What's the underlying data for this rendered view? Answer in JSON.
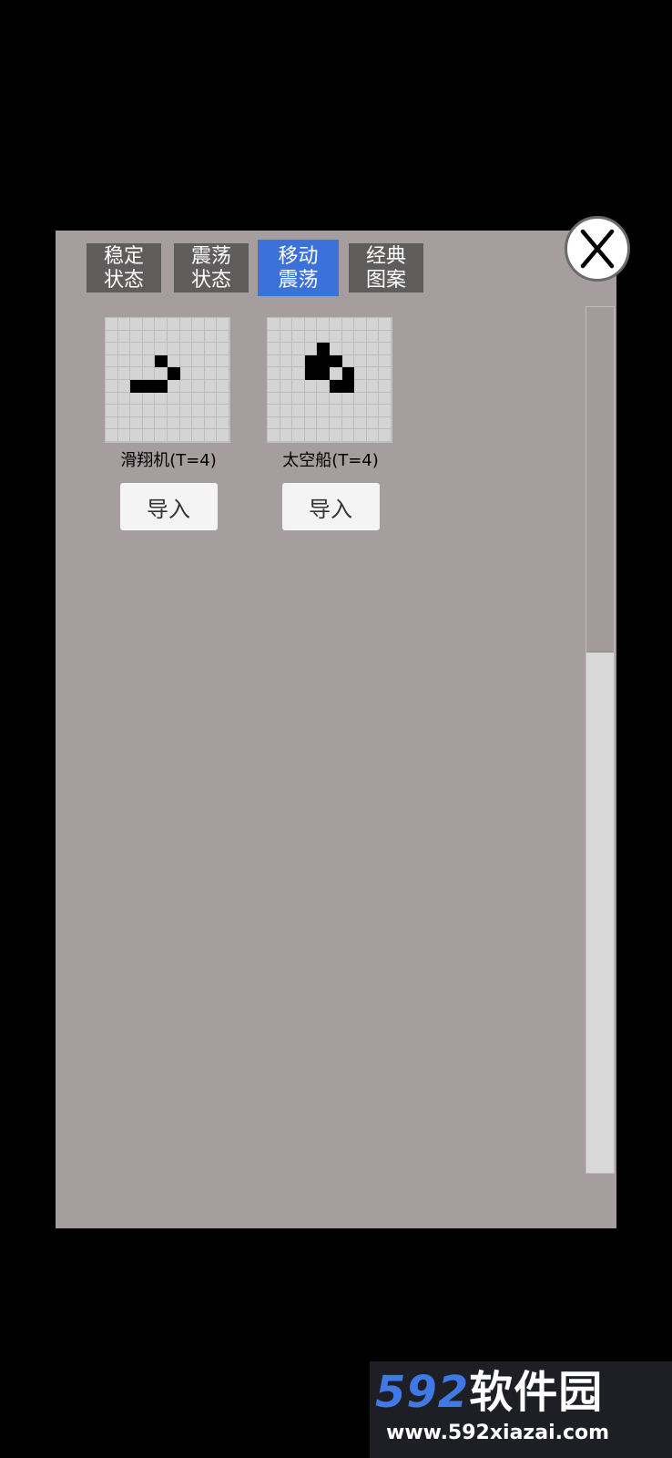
{
  "tabs": [
    {
      "label": "稳定\n状态",
      "active": false
    },
    {
      "label": "震荡\n状态",
      "active": false
    },
    {
      "label": "移动\n震荡",
      "active": true
    },
    {
      "label": "经典\n图案",
      "active": false
    }
  ],
  "close_label": "X",
  "patterns": [
    {
      "name": "滑翔机(T=4)",
      "import_label": "导入",
      "grid_size": 10,
      "alive_cells": [
        [
          3,
          4
        ],
        [
          4,
          5
        ],
        [
          5,
          2
        ],
        [
          5,
          3
        ],
        [
          5,
          4
        ]
      ]
    },
    {
      "name": "太空船(T=4)",
      "import_label": "导入",
      "grid_size": 10,
      "alive_cells": [
        [
          2,
          4
        ],
        [
          3,
          3
        ],
        [
          3,
          4
        ],
        [
          3,
          5
        ],
        [
          4,
          3
        ],
        [
          4,
          4
        ],
        [
          4,
          6
        ],
        [
          5,
          5
        ],
        [
          5,
          6
        ]
      ]
    }
  ],
  "watermark": {
    "brand_num": "592",
    "brand_cn": "软件园",
    "url": "www.592xiazai.com"
  },
  "colors": {
    "panel": "#a59d9e",
    "tab_inactive": "#5f5c5c",
    "tab_active": "#3b72d9"
  }
}
